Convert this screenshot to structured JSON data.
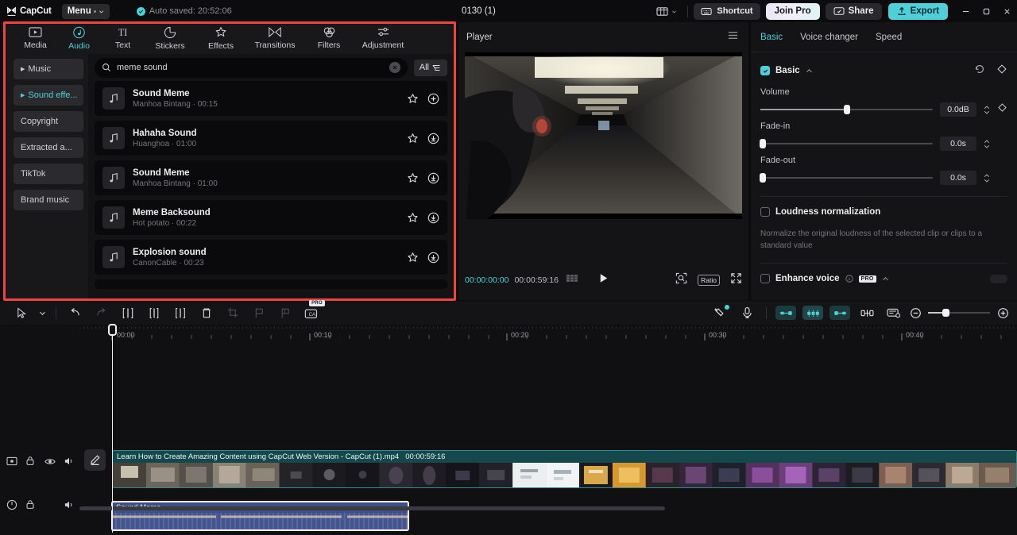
{
  "titlebar": {
    "app_name": "CapCut",
    "menu_label": "Menu",
    "autosave": "Auto saved: 20:52:06",
    "project_title": "0130 (1)",
    "shortcut_label": "Shortcut",
    "join_pro_label": "Join Pro",
    "share_label": "Share",
    "export_label": "Export",
    "icons": {
      "layout": "layout-icon",
      "minimize": "minimize-icon",
      "maximize": "maximize-icon",
      "close": "close-icon"
    }
  },
  "left_panel": {
    "highlight_color": "#f0443f",
    "tabs": [
      {
        "label": "Media",
        "icon": "media-icon",
        "active": false
      },
      {
        "label": "Audio",
        "icon": "audio-note-icon",
        "active": true
      },
      {
        "label": "Text",
        "icon": "text-icon",
        "active": false
      },
      {
        "label": "Stickers",
        "icon": "sticker-icon",
        "active": false
      },
      {
        "label": "Effects",
        "icon": "effects-star-icon",
        "active": false
      },
      {
        "label": "Transitions",
        "icon": "transitions-icon",
        "active": false
      },
      {
        "label": "Filters",
        "icon": "filters-icon",
        "active": false
      },
      {
        "label": "Adjustment",
        "icon": "adjustment-icon",
        "active": false
      }
    ],
    "categories": [
      {
        "label": "Music",
        "expandable": true,
        "active": false
      },
      {
        "label": "Sound effe...",
        "expandable": true,
        "active": true
      },
      {
        "label": "Copyright",
        "expandable": false,
        "active": false
      },
      {
        "label": "Extracted a...",
        "expandable": false,
        "active": false
      },
      {
        "label": "TikTok",
        "expandable": false,
        "active": false
      },
      {
        "label": "Brand music",
        "expandable": false,
        "active": false
      }
    ],
    "search": {
      "value": "meme sound",
      "placeholder": "Search",
      "filter_label": "All"
    },
    "sounds": [
      {
        "title": "Sound Meme",
        "author": "Manhoa Bintang",
        "duration": "00:15",
        "action_icon": "plus-icon"
      },
      {
        "title": "Hahaha Sound",
        "author": "Huanghoa",
        "duration": "01:00",
        "action_icon": "download-icon"
      },
      {
        "title": "Sound Meme",
        "author": "Manhoa Bintang",
        "duration": "01:00",
        "action_icon": "download-icon"
      },
      {
        "title": "Meme Backsound",
        "author": "Hot potato",
        "duration": "00:22",
        "action_icon": "download-icon"
      },
      {
        "title": "Explosion sound",
        "author": "CanonCable",
        "duration": "00:23",
        "action_icon": "download-icon"
      }
    ]
  },
  "player": {
    "title": "Player",
    "current_time": "00:00:00:00",
    "total_time": "00:00:59:16",
    "play_icon": "play-icon",
    "ratio_label": "Ratio",
    "fullscreen_icon": "fullscreen-icon",
    "zoom_icon": "zoom-fit-icon",
    "frames_icon": "frames-icon",
    "menu_icon": "hamburger-icon",
    "accent": "#4fd0d8"
  },
  "right_panel": {
    "tabs": [
      {
        "label": "Basic",
        "active": true
      },
      {
        "label": "Voice changer",
        "active": false
      },
      {
        "label": "Speed",
        "active": false
      }
    ],
    "section_title": "Basic",
    "section_checked": true,
    "reset_icon": "reset-icon",
    "keyframe_icon": "keyframe-icon",
    "controls": [
      {
        "label": "Volume",
        "value": "0.0dB",
        "percent": 50
      },
      {
        "label": "Fade-in",
        "value": "0.0s",
        "percent": 0
      },
      {
        "label": "Fade-out",
        "value": "0.0s",
        "percent": 0
      }
    ],
    "loudness": {
      "label": "Loudness normalization",
      "checked": false,
      "description": "Normalize the original loudness of the selected clip or clips to a standard value"
    },
    "enhance_voice": {
      "label": "Enhance voice",
      "checked": false,
      "badge": "PRO",
      "info_icon": "info-icon"
    }
  },
  "timeline": {
    "tools": [
      {
        "name": "select-tool",
        "icon": "cursor-icon",
        "enabled": true
      },
      {
        "name": "select-dropdown",
        "icon": "chevron-down-icon",
        "enabled": true
      },
      {
        "name": "undo",
        "icon": "undo-icon",
        "enabled": true
      },
      {
        "name": "redo",
        "icon": "redo-icon",
        "enabled": false
      },
      {
        "name": "split",
        "icon": "split-icon",
        "enabled": true
      },
      {
        "name": "trim-left",
        "icon": "trim-left-icon",
        "enabled": true
      },
      {
        "name": "trim-right",
        "icon": "trim-right-icon",
        "enabled": true
      },
      {
        "name": "delete",
        "icon": "trash-icon",
        "enabled": true
      },
      {
        "name": "crop",
        "icon": "crop-icon",
        "enabled": false
      },
      {
        "name": "marker",
        "icon": "flag-icon",
        "enabled": false
      },
      {
        "name": "marker-2",
        "icon": "flag-alt-icon",
        "enabled": false
      },
      {
        "name": "auto-caption-pro",
        "icon": "captions-pro-icon",
        "enabled": true
      }
    ],
    "right_tools": [
      {
        "name": "auto-enhance",
        "icon": "magic-wand-icon"
      },
      {
        "name": "record-voiceover",
        "icon": "microphone-icon"
      },
      {
        "name": "mix-left",
        "icon": "mix-left-icon"
      },
      {
        "name": "mix-center",
        "icon": "mix-center-icon"
      },
      {
        "name": "mix-right",
        "icon": "mix-right-icon"
      },
      {
        "name": "link-clips",
        "icon": "link-icon"
      },
      {
        "name": "preview-render",
        "icon": "preview-render-icon"
      }
    ],
    "zoom": {
      "out_icon": "zoom-out-icon",
      "in_icon": "zoom-in-icon",
      "level": 22
    },
    "ruler_labels": [
      "00:00",
      "00:10",
      "00:20",
      "00:30",
      "00:40"
    ],
    "playhead_time": "00:00",
    "video_track": {
      "name": "Learn How to Create Amazing Content using CapCut Web Version - CapCut (1).mp4",
      "duration": "00:00:59:16",
      "icons": [
        "video-thumb-icon",
        "lock-icon",
        "eye-icon",
        "speaker-icon"
      ],
      "edit_icon": "edit-pen-icon"
    },
    "audio_track": {
      "name": "Sound Meme",
      "icons": [
        "audio-power-icon",
        "lock-icon",
        "speaker-icon"
      ]
    }
  }
}
